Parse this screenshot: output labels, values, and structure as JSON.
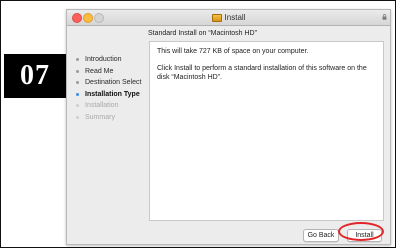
{
  "step_badge": "07",
  "window": {
    "title": "Install",
    "subtitle": "Standard Install on “Macintosh HD”"
  },
  "sidebar": {
    "items": [
      {
        "label": "Introduction",
        "state": "done"
      },
      {
        "label": "Read Me",
        "state": "done"
      },
      {
        "label": "Destination Select",
        "state": "done"
      },
      {
        "label": "Installation Type",
        "state": "active"
      },
      {
        "label": "Installation",
        "state": "future"
      },
      {
        "label": "Summary",
        "state": "future"
      }
    ]
  },
  "content": {
    "line1": "This will take 727 KB of space on your computer.",
    "line2": "Click Install to perform a standard installation of this software on the disk “Macintosh HD”."
  },
  "buttons": {
    "go_back": "Go Back",
    "install": "Install"
  },
  "colors": {
    "active_bullet": "#3b8ced",
    "highlight_ring": "#e0262a",
    "badge_bg": "#000000"
  },
  "icons": {
    "title": "package-icon",
    "titlebar_right": "lock-icon"
  }
}
